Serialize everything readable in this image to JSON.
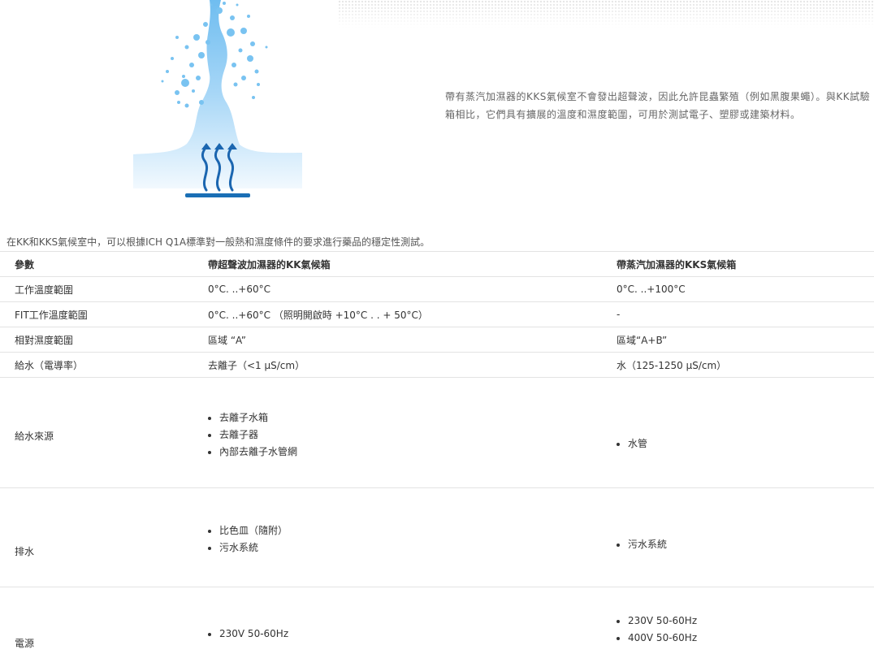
{
  "intro_text": "帶有蒸汽加濕器的KKS氣候室不會發出超聲波，因此允許昆蟲繁殖（例如黑腹果蠅）。與KK試驗箱相比，它們具有擴展的溫度和濕度範圍，可用於測試電子、塑膠或建築材料。",
  "table_caption": "在KK和KKS氣候室中，可以根據ICH Q1A標準對一般熱和濕度條件的要求進行藥品的穩定性測試。",
  "table": {
    "headers": [
      "參數",
      "帶超聲波加濕器的KK氣候箱",
      "帶蒸汽加濕器的KKS氣候箱"
    ],
    "rows": [
      {
        "param": "工作溫度範圍",
        "kk": "0°C. ..+60°C",
        "kks": "0°C. ..+100°C"
      },
      {
        "param": "FIT工作溫度範圍",
        "kk": "0°C. ..+60°C （照明開啟時 +10°C . . + 50°C）",
        "kks": "-"
      },
      {
        "param": "相對濕度範圍",
        "kk": "區域 “A”",
        "kks": "區域“A+B”"
      },
      {
        "param": "給水（電導率）",
        "kk": "去離子（<1 µS/cm）",
        "kks": "水（125-1250 µS/cm）"
      }
    ],
    "water_source": {
      "param": "給水來源",
      "kk": [
        "去離子水箱",
        "去離子器",
        "內部去離子水管網"
      ],
      "kks": [
        "水管"
      ]
    },
    "drain": {
      "param": "排水",
      "kk": [
        "比色皿（隨附）",
        "污水系統"
      ],
      "kks": [
        "污水系統"
      ]
    },
    "power": {
      "param": "電源",
      "kk": [
        "230V 50-60Hz"
      ],
      "kks": [
        "230V 50-60Hz",
        "400V 50-60Hz"
      ]
    }
  },
  "colors": {
    "water_light": "#cfe8fb",
    "water_mid": "#79c3f1",
    "water_dark": "#1a6fb5",
    "arrow": "#1b66b0",
    "text": "#333333",
    "border": "#e3e3e3"
  }
}
